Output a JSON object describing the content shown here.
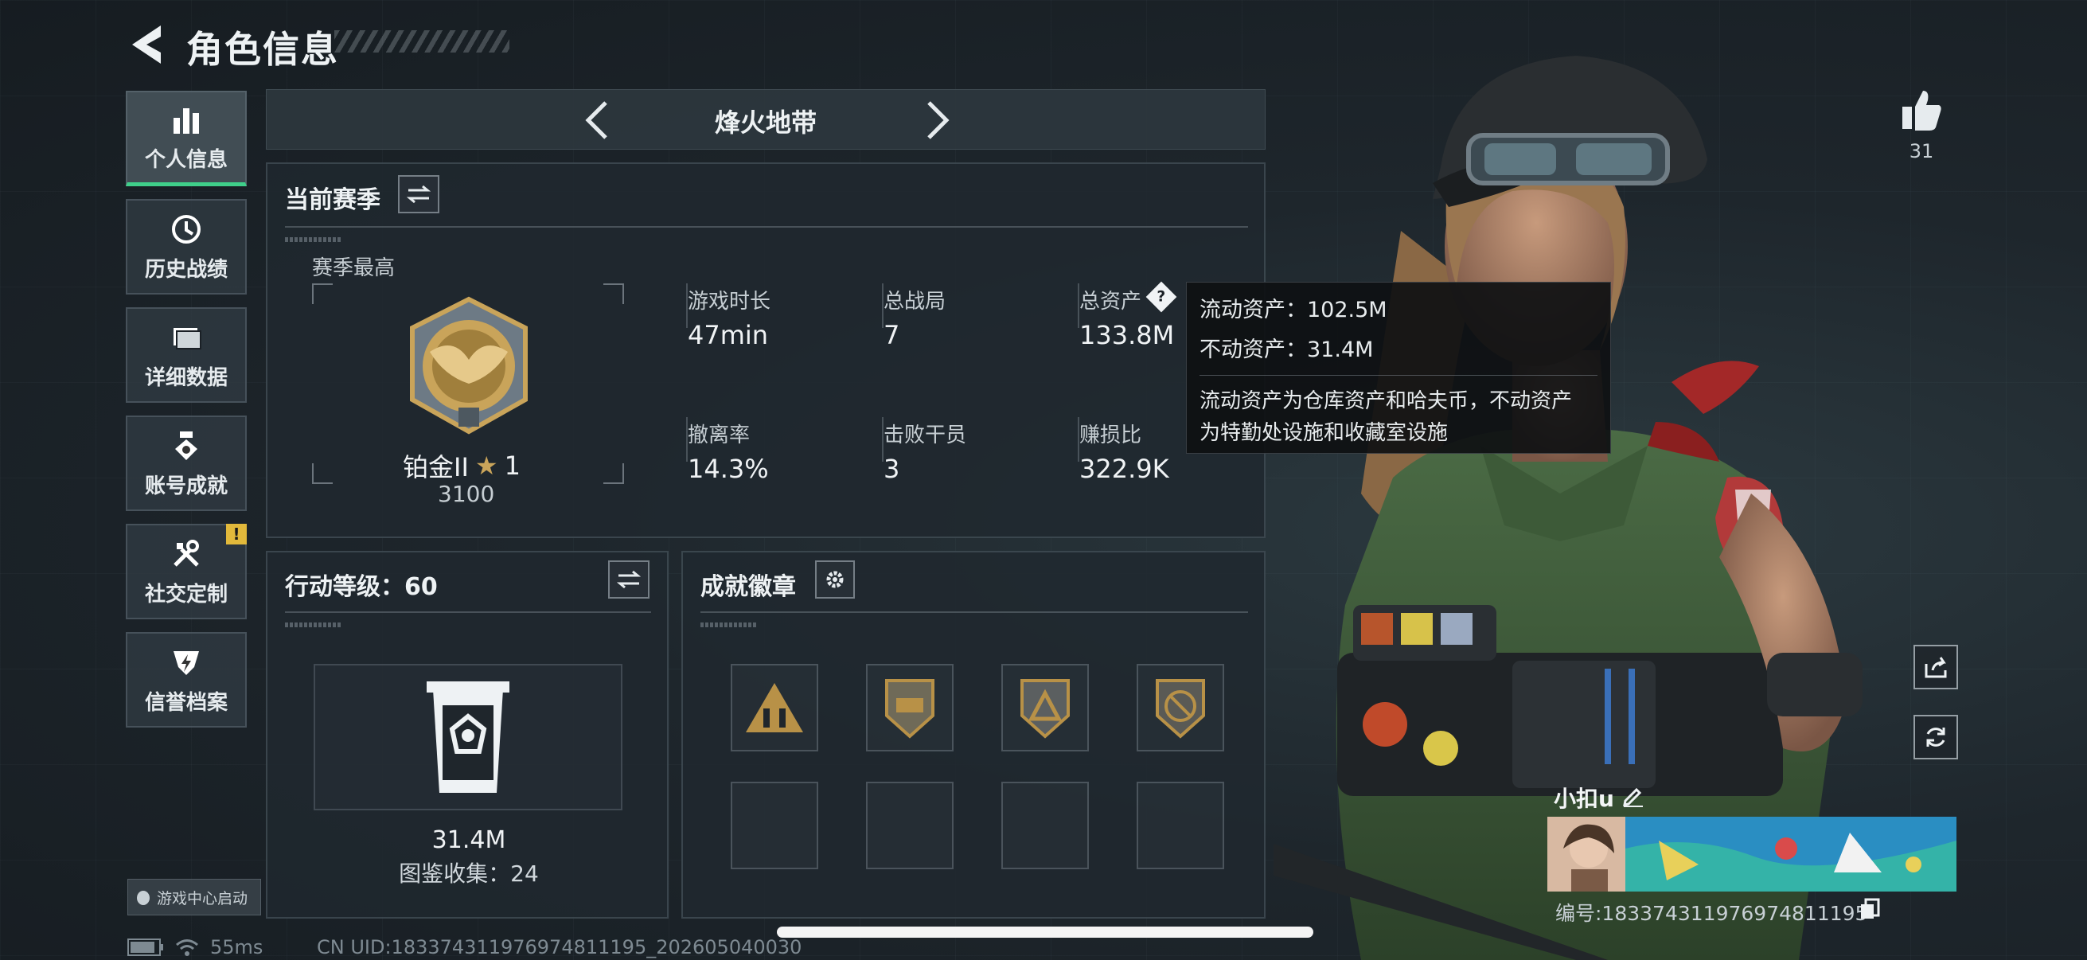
{
  "header": {
    "title": "角色信息"
  },
  "sidebar": {
    "items": [
      {
        "label": "个人信息",
        "icon": "bar-chart-icon",
        "active": true
      },
      {
        "label": "历史战绩",
        "icon": "history-clock-icon",
        "active": false
      },
      {
        "label": "详细数据",
        "icon": "folder-icon",
        "active": false
      },
      {
        "label": "账号成就",
        "icon": "medal-icon",
        "active": false
      },
      {
        "label": "社交定制",
        "icon": "tools-icon",
        "active": false,
        "badge": "!"
      },
      {
        "label": "信誉档案",
        "icon": "shield-bolt-icon",
        "active": false
      }
    ],
    "game_center": "游戏中心启动"
  },
  "mode_selector": {
    "title": "烽火地带"
  },
  "season": {
    "title": "当前赛季",
    "best_label": "赛季最高",
    "rank_name": "铂金II",
    "rank_stars": "1",
    "rank_points": "3100",
    "stats": [
      {
        "label": "游戏时长",
        "value": "47min"
      },
      {
        "label": "总战局",
        "value": "7"
      },
      {
        "label": "总资产",
        "value": "133.8M"
      },
      {
        "label": "撤离率",
        "value": "14.3%"
      },
      {
        "label": "击败干员",
        "value": "3"
      },
      {
        "label": "赚损比",
        "value": "322.9K"
      }
    ]
  },
  "tooltip": {
    "liquid": "流动资产：102.5M",
    "fixed": "不动资产：31.4M",
    "desc_line1": "流动资产为仓库资产和哈夫币，不动资产",
    "desc_line2": "为特勤处设施和收藏室设施"
  },
  "level": {
    "title": "行动等级：60",
    "value": "31.4M",
    "collection": "图鉴收集：24"
  },
  "achievements": {
    "title": "成就徽章",
    "badges": [
      "triangle-soldiers-icon",
      "vehicle-badge-icon",
      "triangle-badge-icon",
      "no-gun-badge-icon"
    ]
  },
  "right_panel": {
    "like_count": "31"
  },
  "player": {
    "name": "小扣u",
    "id": "编号:1833743119769748111​95"
  },
  "status": {
    "ping": "55ms",
    "uid": "CN UID:1833743119769748111​95_202605040030"
  },
  "colors": {
    "accent": "#3fcf8a",
    "warning": "#e2b93b",
    "gold": "#c9a45a"
  }
}
